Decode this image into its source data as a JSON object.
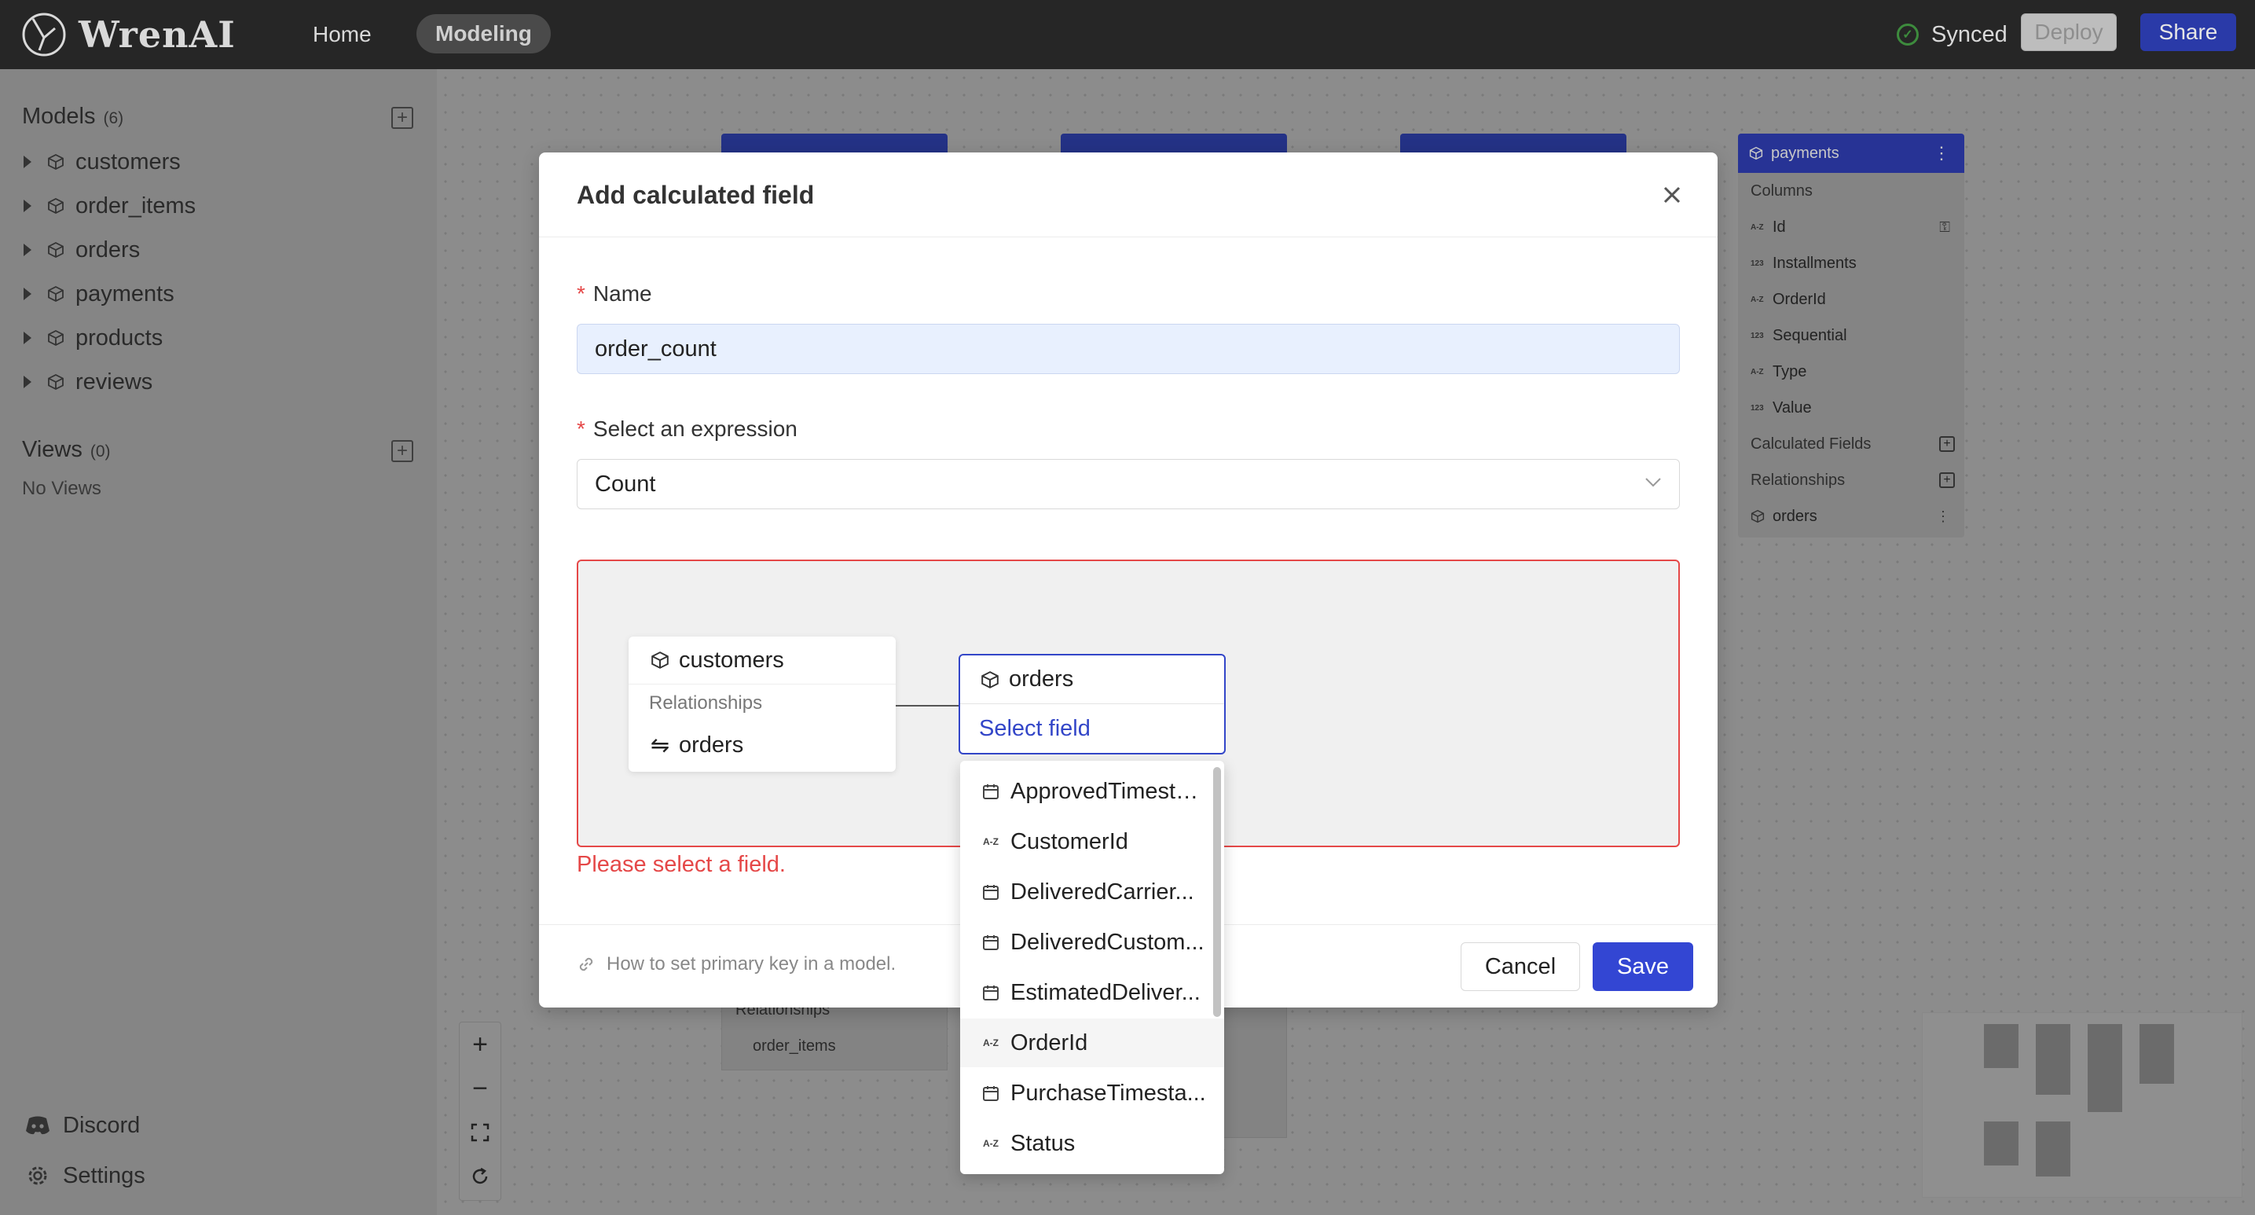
{
  "app": {
    "logo_text": "WrenAI",
    "nav": {
      "home": "Home",
      "modeling": "Modeling"
    },
    "status": "Synced",
    "deploy_label": "Deploy",
    "share_label": "Share"
  },
  "sidebar": {
    "models_title": "Models",
    "models_count": "(6)",
    "models": [
      {
        "label": "customers"
      },
      {
        "label": "order_items"
      },
      {
        "label": "orders"
      },
      {
        "label": "payments"
      },
      {
        "label": "products"
      },
      {
        "label": "reviews"
      }
    ],
    "views_title": "Views",
    "views_count": "(0)",
    "no_views": "No Views",
    "footer": {
      "discord": "Discord",
      "settings": "Settings"
    }
  },
  "canvas": {
    "payments_node": {
      "title": "payments",
      "columns_label": "Columns",
      "columns": [
        {
          "type": "A-Z",
          "name": "Id"
        },
        {
          "type": "123",
          "name": "Installments"
        },
        {
          "type": "A-Z",
          "name": "OrderId"
        },
        {
          "type": "123",
          "name": "Sequential"
        },
        {
          "type": "A-Z",
          "name": "Type"
        },
        {
          "type": "123",
          "name": "Value"
        }
      ],
      "calculated_fields_label": "Calculated Fields",
      "relationships_label": "Relationships",
      "relation_item": "orders"
    },
    "bg_relationships_label": "Relationships",
    "bg_order_items": "order_items",
    "zoom": {
      "zoom_in": "+",
      "zoom_out": "−"
    }
  },
  "modal": {
    "title": "Add calculated field",
    "name_label": "Name",
    "name_value": "order_count",
    "expression_label": "Select an expression",
    "expression_value": "Count",
    "lineage": {
      "source_model": "customers",
      "relationships_label": "Relationships",
      "relation": "orders",
      "target_model": "orders",
      "select_field": "Select field"
    },
    "error": "Please select a field.",
    "help_link": "How to set primary key in a model.",
    "cancel_label": "Cancel",
    "save_label": "Save"
  },
  "field_dropdown": {
    "items": [
      {
        "type": "date",
        "label": "ApprovedTimesta..."
      },
      {
        "type": "A-Z",
        "label": "CustomerId"
      },
      {
        "type": "date",
        "label": "DeliveredCarrier..."
      },
      {
        "type": "date",
        "label": "DeliveredCustom..."
      },
      {
        "type": "date",
        "label": "EstimatedDeliver..."
      },
      {
        "type": "A-Z",
        "label": "OrderId"
      },
      {
        "type": "date",
        "label": "PurchaseTimesta..."
      },
      {
        "type": "A-Z",
        "label": "Status"
      }
    ],
    "hovered_index": 5
  },
  "colors": {
    "topbar": "#262626",
    "primary": "#3346d3",
    "error": "#e54848",
    "input_autofill": "#e8f0fe"
  }
}
